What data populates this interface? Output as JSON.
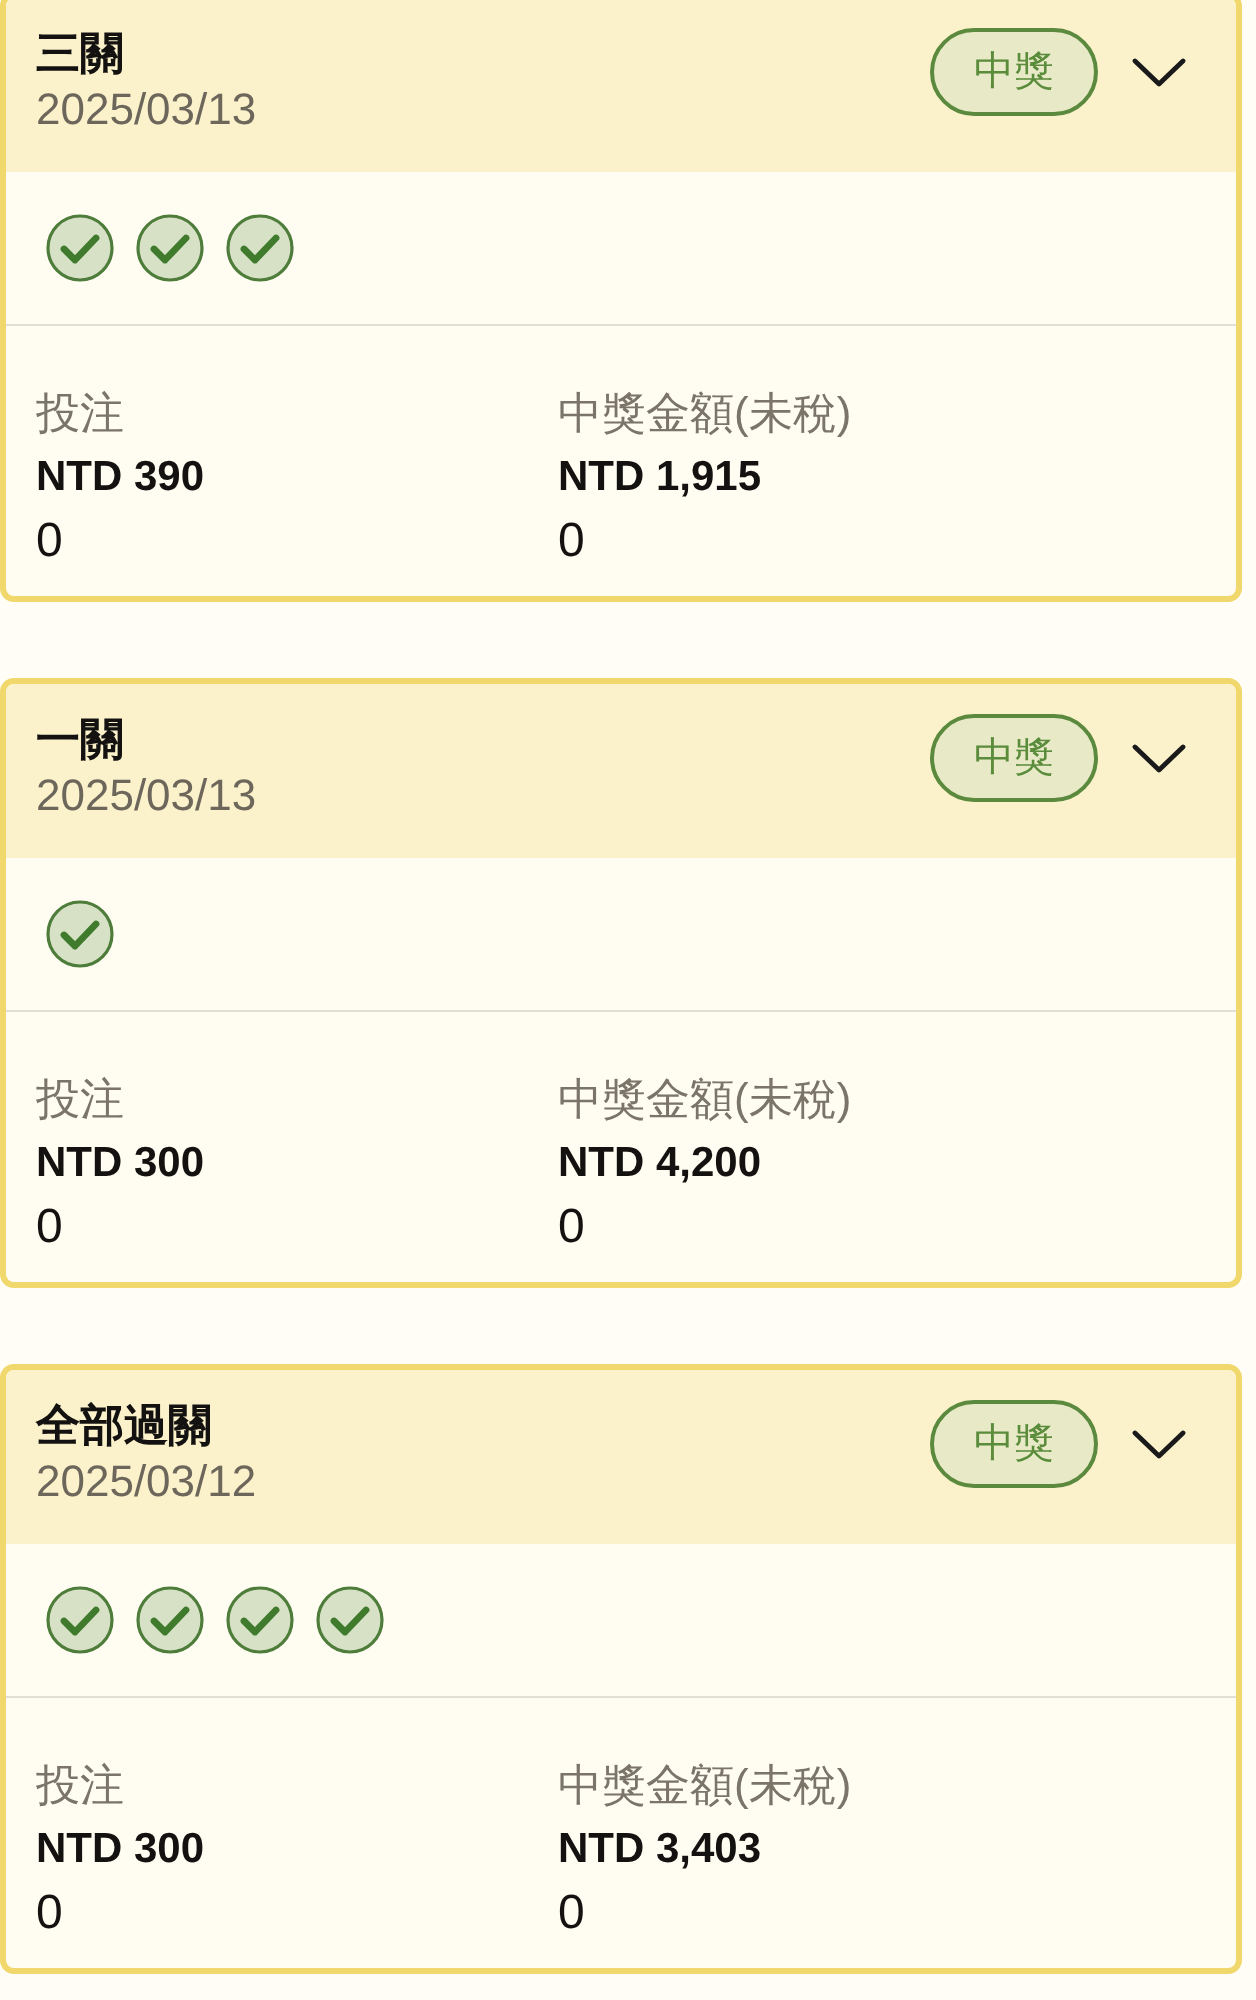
{
  "tickets": [
    {
      "title": "三關",
      "date": "2025/03/13",
      "status": "中獎",
      "legs": [
        {
          "won": true
        },
        {
          "won": true
        },
        {
          "won": true
        }
      ],
      "stats": [
        {
          "label": "投注",
          "amount": "NTD 390",
          "value": "0"
        },
        {
          "label": "中獎金額(未稅)",
          "amount": "NTD 1,915",
          "value": "0"
        }
      ]
    },
    {
      "title": "一關",
      "date": "2025/03/13",
      "status": "中獎",
      "legs": [
        {
          "won": true
        }
      ],
      "stats": [
        {
          "label": "投注",
          "amount": "NTD 300",
          "value": "0"
        },
        {
          "label": "中獎金額(未稅)",
          "amount": "NTD 4,200",
          "value": "0"
        }
      ]
    },
    {
      "title": "全部過關",
      "date": "2025/03/12",
      "status": "中獎",
      "legs": [
        {
          "won": true
        },
        {
          "won": true
        },
        {
          "won": true
        },
        {
          "won": true
        }
      ],
      "stats": [
        {
          "label": "投注",
          "amount": "NTD 300",
          "value": "0"
        },
        {
          "label": "中獎金額(未稅)",
          "amount": "NTD 3,403",
          "value": "0"
        }
      ]
    }
  ]
}
